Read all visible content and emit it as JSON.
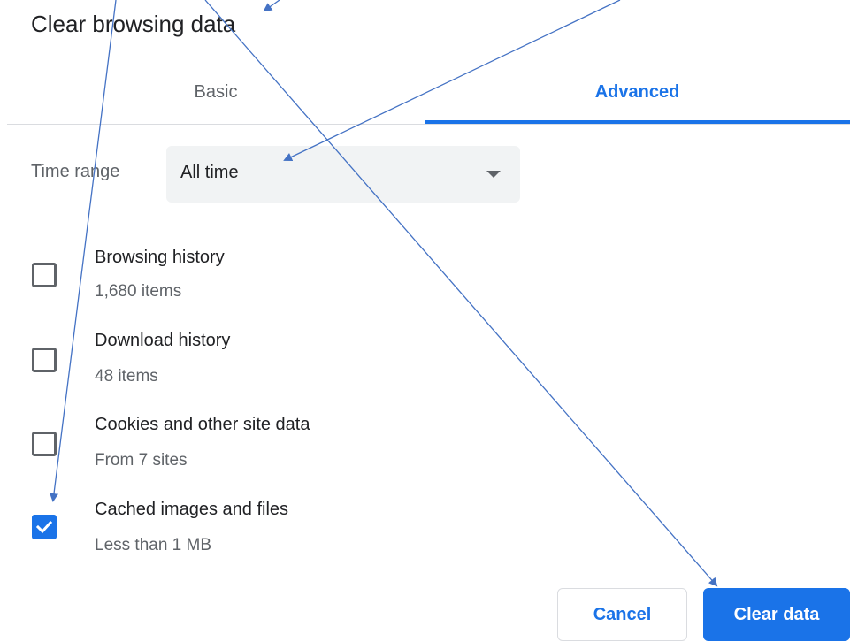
{
  "dialog": {
    "title": "Clear browsing data"
  },
  "tabs": [
    {
      "label": "Basic",
      "active": false
    },
    {
      "label": "Advanced",
      "active": true
    }
  ],
  "time_range": {
    "label": "Time range",
    "value": "All time"
  },
  "options": [
    {
      "label": "Browsing history",
      "detail": "1,680 items",
      "checked": false
    },
    {
      "label": "Download history",
      "detail": "48 items",
      "checked": false
    },
    {
      "label": "Cookies and other site data",
      "detail": "From 7 sites",
      "checked": false
    },
    {
      "label": "Cached images and files",
      "detail": "Less than 1 MB",
      "checked": true
    }
  ],
  "buttons": {
    "cancel_label": "Cancel",
    "clear_label": "Clear data"
  },
  "colors": {
    "accent": "#1a73e8",
    "annotation_arrow": "#4472c4",
    "select_bg": "#f1f3f4"
  }
}
